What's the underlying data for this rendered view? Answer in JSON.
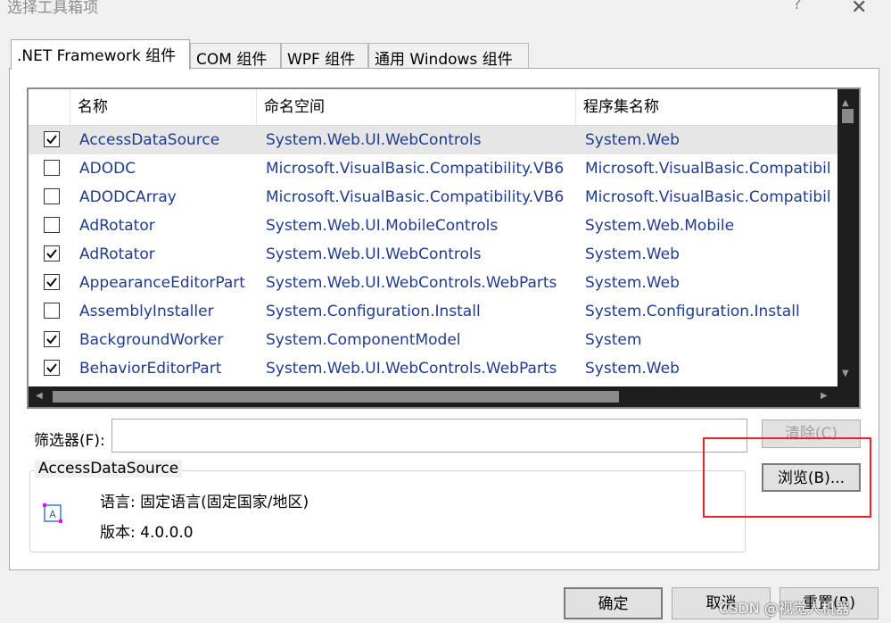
{
  "window": {
    "title": "选择工具箱项",
    "help": "?",
    "close": "✕"
  },
  "tabs": [
    ".NET Framework 组件",
    "COM 组件",
    "WPF 组件",
    "通用 Windows 组件"
  ],
  "grid": {
    "columns": [
      "名称",
      "命名空间",
      "程序集名称"
    ],
    "rows": [
      {
        "checked": true,
        "name": "AccessDataSource",
        "ns": "System.Web.UI.WebControls",
        "asm": "System.Web"
      },
      {
        "checked": false,
        "name": "ADODC",
        "ns": "Microsoft.VisualBasic.Compatibility.VB6",
        "asm": "Microsoft.VisualBasic.Compatibil"
      },
      {
        "checked": false,
        "name": "ADODCArray",
        "ns": "Microsoft.VisualBasic.Compatibility.VB6",
        "asm": "Microsoft.VisualBasic.Compatibil"
      },
      {
        "checked": false,
        "name": "AdRotator",
        "ns": "System.Web.UI.MobileControls",
        "asm": "System.Web.Mobile"
      },
      {
        "checked": true,
        "name": "AdRotator",
        "ns": "System.Web.UI.WebControls",
        "asm": "System.Web"
      },
      {
        "checked": true,
        "name": "AppearanceEditorPart",
        "ns": "System.Web.UI.WebControls.WebParts",
        "asm": "System.Web"
      },
      {
        "checked": false,
        "name": "AssemblyInstaller",
        "ns": "System.Configuration.Install",
        "asm": "System.Configuration.Install"
      },
      {
        "checked": true,
        "name": "BackgroundWorker",
        "ns": "System.ComponentModel",
        "asm": "System"
      },
      {
        "checked": true,
        "name": "BehaviorEditorPart",
        "ns": "System.Web.UI.WebControls.WebParts",
        "asm": "System.Web"
      }
    ]
  },
  "filter": {
    "label": "筛选器(F):",
    "value": "",
    "clear": "清除(C)"
  },
  "details": {
    "group_title": "AccessDataSource",
    "language": "语言: 固定语言(固定国家/地区)",
    "version": "版本: 4.0.0.0"
  },
  "browse": "浏览(B)...",
  "footer": {
    "ok": "确定",
    "cancel": "取消",
    "reset": "重置(R)"
  },
  "watermark": "CSDN @视觉人机器",
  "colors": {
    "highlight": "#e0262a",
    "link_text": "#1f3b8c",
    "scrollbar": "#1e1e1e"
  }
}
